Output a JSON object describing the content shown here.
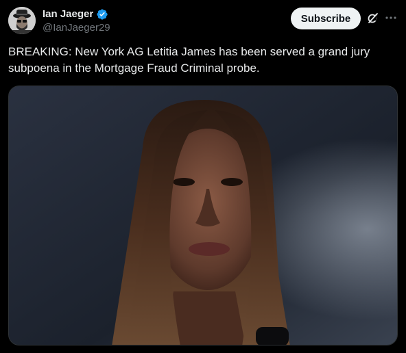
{
  "author": {
    "display_name": "Ian Jaeger",
    "handle": "@IanJaeger29",
    "verified_icon": "verified-badge-icon",
    "verified_color": "#1d9bf0"
  },
  "actions": {
    "subscribe_label": "Subscribe",
    "grok_icon": "grok-icon",
    "more_icon": "more-options-icon"
  },
  "post": {
    "text": "BREAKING: New York AG Letitia James has been served a grand jury subpoena in the Mortgage Fraud Criminal probe."
  },
  "media": {
    "description_icon": "photo-portrait"
  },
  "colors": {
    "background": "#000000",
    "text_primary": "#e7e9ea",
    "text_secondary": "#71767b",
    "button_bg": "#eff3f4"
  }
}
